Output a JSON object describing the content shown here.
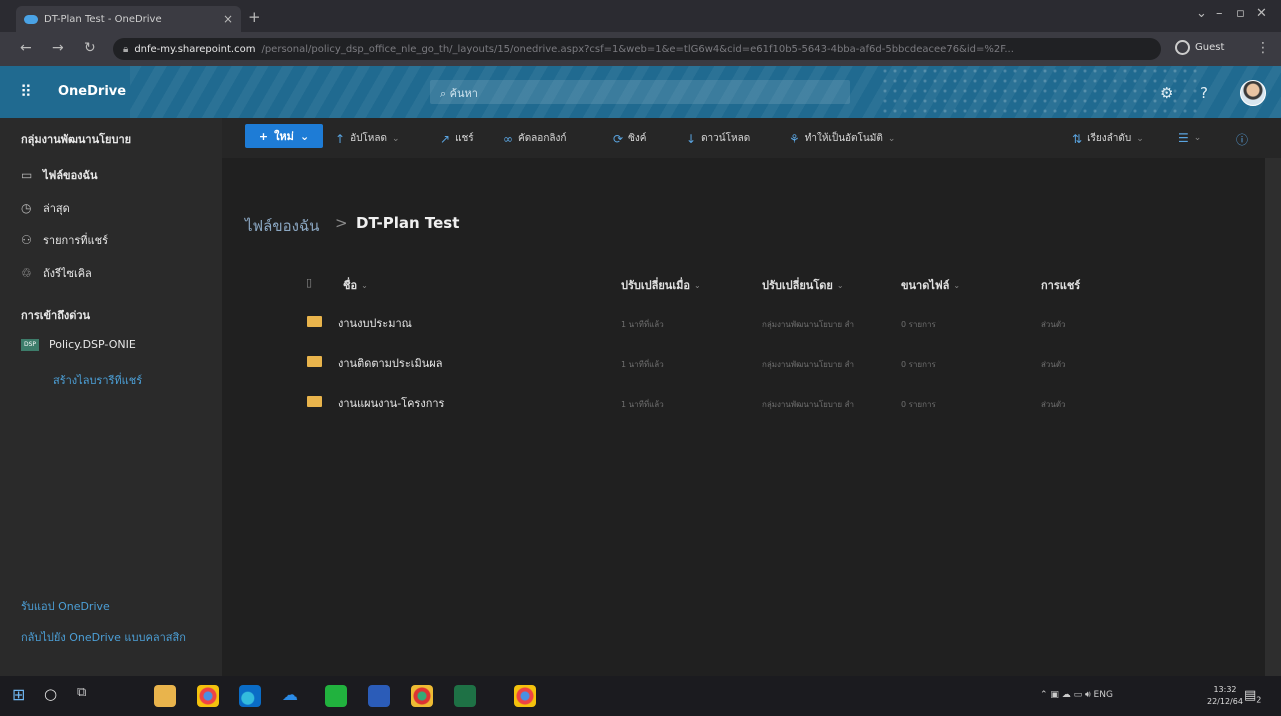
{
  "browser": {
    "tab_title": "DT-Plan Test - OneDrive",
    "tab_close": "×",
    "new_tab": "+",
    "url_host": "dnfe-my.sharepoint.com",
    "url_path": "/personal/policy_dsp_office_nle_go_th/_layouts/15/onedrive.aspx?csf=1&web=1&e=tlG6w4&cid=e61f10b5-5643-4bba-af6d-5bbcdeacee76&id=%2F...",
    "profile": "Guest"
  },
  "suite": {
    "app_name": "OneDrive",
    "search_placeholder": "ค้นหา"
  },
  "left_nav": {
    "group_title": "กลุ่มงานพัฒนานโยบาย",
    "items": [
      {
        "label": "ไฟล์ของฉัน",
        "icon": "folder-icon"
      },
      {
        "label": "ล่าสุด",
        "icon": "clock-icon"
      },
      {
        "label": "รายการที่แชร์",
        "icon": "people-icon"
      },
      {
        "label": "ถังรีไซเคิล",
        "icon": "recycle-bin-icon"
      }
    ],
    "quick_access_title": "การเข้าถึงด่วน",
    "library_badge": "DSP",
    "library": "Policy.DSP-ONIE",
    "create_library": "สร้างไลบรารีที่แชร์",
    "get_app": "รับแอป OneDrive",
    "classic": "กลับไปยัง OneDrive แบบคลาสสิก"
  },
  "command_bar": {
    "new": "ใหม่",
    "upload": "อัปโหลด",
    "share": "แชร์",
    "copy_link": "คัดลอกลิงก์",
    "sync": "ซิงค์",
    "download": "ดาวน์โหลด",
    "automate": "ทำให้เป็นอัตโนมัติ",
    "sort": "เรียงลำดับ"
  },
  "breadcrumb": {
    "root": "ไฟล์ของฉัน",
    "separator": ">",
    "current": "DT-Plan Test"
  },
  "columns": {
    "name": "ชื่อ",
    "modified": "ปรับเปลี่ยนเมื่อ",
    "modified_by": "ปรับเปลี่ยนโดย",
    "size": "ขนาดไฟล์",
    "sharing": "การแชร์"
  },
  "files": [
    {
      "name": "งานงบประมาณ",
      "modified": "1 นาทีที่แล้ว",
      "modified_by": "กลุ่มงานพัฒนานโยบาย สำ",
      "size": "0 รายการ",
      "sharing": "ส่วนตัว"
    },
    {
      "name": "งานติดตามประเมินผล",
      "modified": "1 นาทีที่แล้ว",
      "modified_by": "กลุ่มงานพัฒนานโยบาย สำ",
      "size": "0 รายการ",
      "sharing": "ส่วนตัว"
    },
    {
      "name": "งานแผนงาน-โครงการ",
      "modified": "1 นาทีที่แล้ว",
      "modified_by": "กลุ่มงานพัฒนานโยบาย สำ",
      "size": "0 รายการ",
      "sharing": "ส่วนตัว"
    }
  ],
  "taskbar": {
    "tray_lang": "ENG",
    "time": "13:32",
    "date": "22/12/64",
    "notifications": "2"
  }
}
